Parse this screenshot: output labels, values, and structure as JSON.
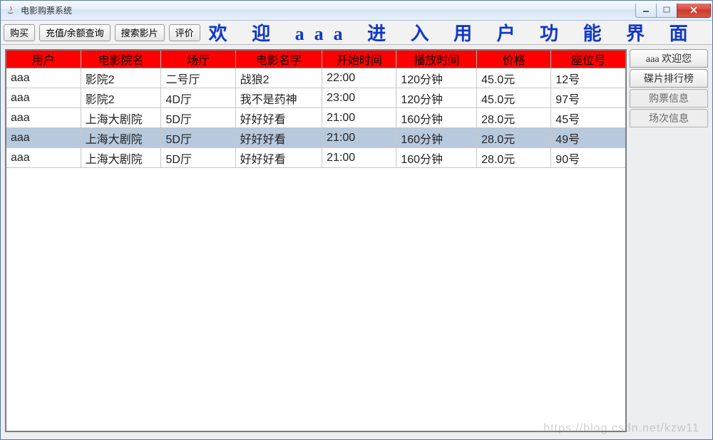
{
  "window": {
    "title": "电影购票系统"
  },
  "toolbar": {
    "buy": "购买",
    "recharge": "充值/余额查询",
    "search": "搜索影片",
    "rate": "评价"
  },
  "banner": "欢 迎 aaa 进 入 用 户 功 能 界 面",
  "table": {
    "headers": [
      "用户",
      "电影院名",
      "场厅",
      "电影名字",
      "开始时间",
      "播放时间",
      "价格",
      "座位号"
    ],
    "rows": [
      {
        "user": "aaa",
        "cinema": "影院2",
        "hall": "二号厅",
        "movie": "战狼2",
        "start": "22:00",
        "duration": "120分钟",
        "price": "45.0元",
        "seat": "12号",
        "selected": false
      },
      {
        "user": "aaa",
        "cinema": "影院2",
        "hall": "4D厅",
        "movie": "我不是药神",
        "start": "23:00",
        "duration": "120分钟",
        "price": "45.0元",
        "seat": "97号",
        "selected": false
      },
      {
        "user": "aaa",
        "cinema": "上海大剧院",
        "hall": "5D厅",
        "movie": "好好好看",
        "start": "21:00",
        "duration": "160分钟",
        "price": "28.0元",
        "seat": "45号",
        "selected": false
      },
      {
        "user": "aaa",
        "cinema": "上海大剧院",
        "hall": "5D厅",
        "movie": "好好好看",
        "start": "21:00",
        "duration": "160分钟",
        "price": "28.0元",
        "seat": "49号",
        "selected": true
      },
      {
        "user": "aaa",
        "cinema": "上海大剧院",
        "hall": "5D厅",
        "movie": "好好好看",
        "start": "21:00",
        "duration": "160分钟",
        "price": "28.0元",
        "seat": "90号",
        "selected": false
      }
    ]
  },
  "side_tabs": [
    {
      "label": "aaa 欢迎您",
      "active": true
    },
    {
      "label": "碟片排行榜",
      "active": true
    },
    {
      "label": "购票信息",
      "active": false
    },
    {
      "label": "场次信息",
      "active": false
    }
  ],
  "watermark": "https://blog.csdn.net/kzw11"
}
